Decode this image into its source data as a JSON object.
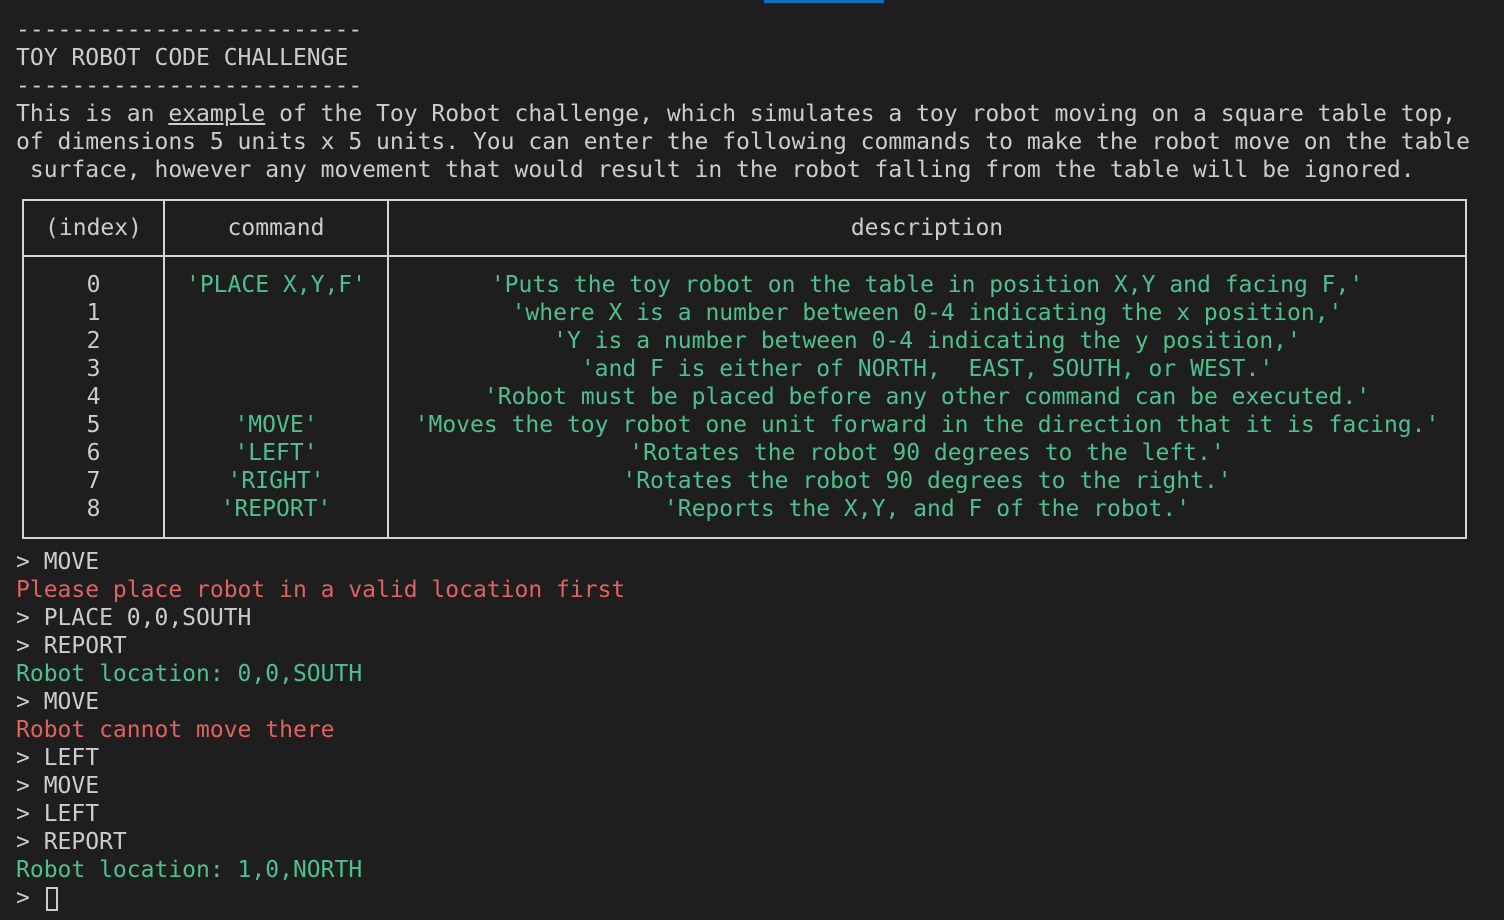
{
  "header": {
    "rule_top": "-------------------------",
    "title": "TOY ROBOT CODE CHALLENGE",
    "rule_bottom": "-------------------------"
  },
  "intro": {
    "line1_pre": "This is an ",
    "line1_link": "example",
    "line1_post": " of the Toy Robot challenge, which simulates a toy robot moving on a square table top,",
    "line2": "of dimensions 5 units x 5 units. You can enter the following commands to make the robot move on the table",
    "line3": " surface, however any movement that would result in the robot falling from the table will be ignored."
  },
  "table": {
    "headers": [
      "(index)",
      "command",
      "description"
    ],
    "rows": [
      {
        "index": "0",
        "command": "'PLACE X,Y,F'",
        "description": "'Puts the toy robot on the table in position X,Y and facing F,'"
      },
      {
        "index": "1",
        "command": "",
        "description": "'where X is a number between 0-4 indicating the x position,'"
      },
      {
        "index": "2",
        "command": "",
        "description": "'Y is a number between 0-4 indicating the y position,'"
      },
      {
        "index": "3",
        "command": "",
        "description": "'and F is either of NORTH,  EAST, SOUTH, or WEST.'"
      },
      {
        "index": "4",
        "command": "",
        "description": "'Robot must be placed before any other command can be executed.'"
      },
      {
        "index": "5",
        "command": "'MOVE'",
        "description": "'Moves the toy robot one unit forward in the direction that it is facing.'"
      },
      {
        "index": "6",
        "command": "'LEFT'",
        "description": "'Rotates the robot 90 degrees to the left.'"
      },
      {
        "index": "7",
        "command": "'RIGHT'",
        "description": "'Rotates the robot 90 degrees to the right.'"
      },
      {
        "index": "8",
        "command": "'REPORT'",
        "description": "'Reports the X,Y, and F of the robot.'"
      }
    ]
  },
  "session": [
    {
      "text": "> MOVE",
      "kind": "input"
    },
    {
      "text": "Please place robot in a valid location first",
      "kind": "error"
    },
    {
      "text": "> PLACE 0,0,SOUTH",
      "kind": "input"
    },
    {
      "text": "> REPORT",
      "kind": "input"
    },
    {
      "text": "Robot location: 0,0,SOUTH",
      "kind": "output"
    },
    {
      "text": "> MOVE",
      "kind": "input"
    },
    {
      "text": "Robot cannot move there",
      "kind": "error"
    },
    {
      "text": "> LEFT",
      "kind": "input"
    },
    {
      "text": "> MOVE",
      "kind": "input"
    },
    {
      "text": "> LEFT",
      "kind": "input"
    },
    {
      "text": "> REPORT",
      "kind": "input"
    },
    {
      "text": "Robot location: 1,0,NORTH",
      "kind": "output"
    }
  ],
  "prompt": {
    "symbol": "> "
  },
  "colors": {
    "background": "#1e1e1e",
    "foreground": "#cccccc",
    "success": "#4ec08d",
    "error": "#e0625f",
    "accent": "#0e70c0"
  }
}
